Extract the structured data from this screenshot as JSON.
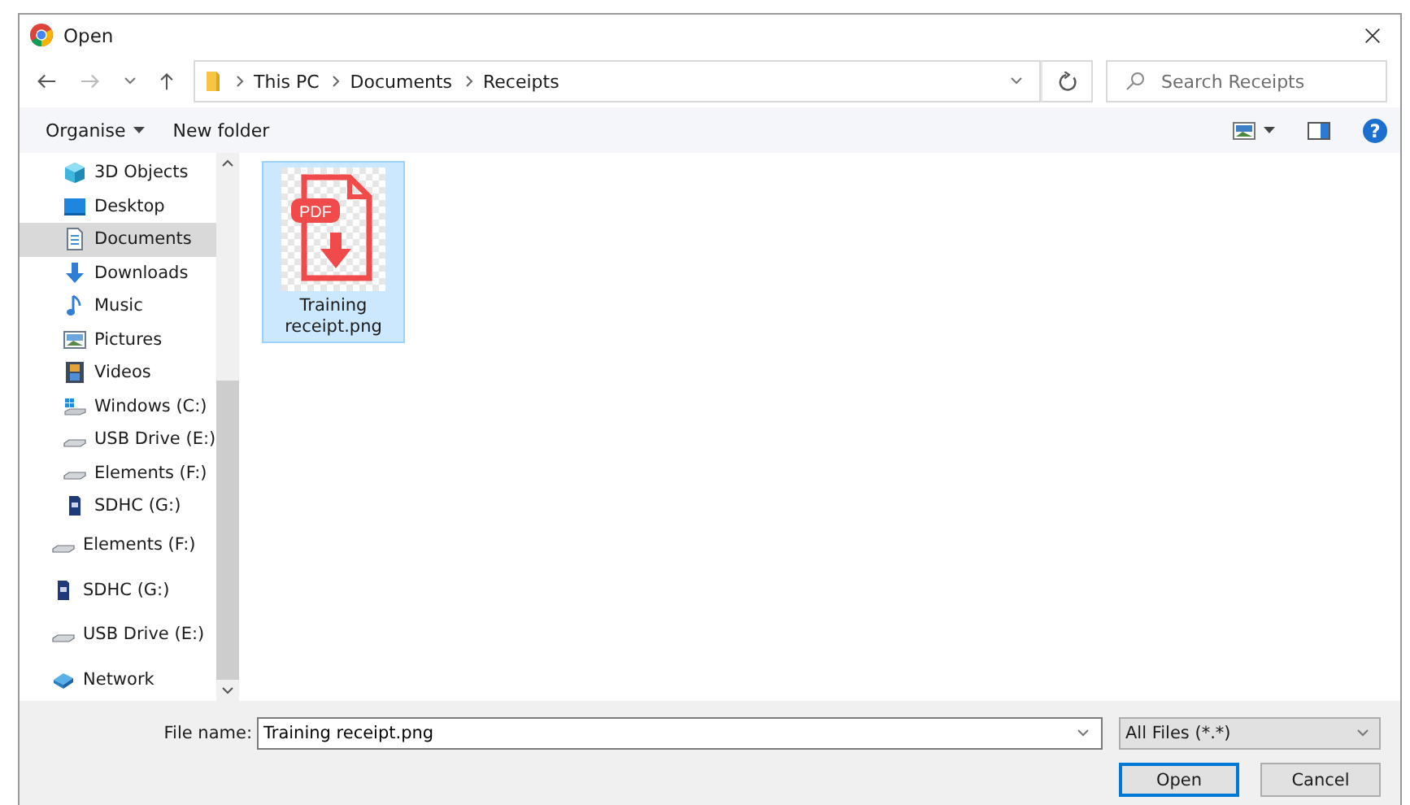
{
  "window": {
    "title": "Open"
  },
  "address": {
    "crumbs": [
      "This PC",
      "Documents",
      "Receipts"
    ]
  },
  "search": {
    "placeholder": "Search Receipts"
  },
  "toolbar": {
    "organise": "Organise",
    "new_folder": "New folder",
    "help": "?"
  },
  "sidebar": {
    "this_pc_items": [
      {
        "label": "3D Objects",
        "kind": "cube",
        "selected": false
      },
      {
        "label": "Desktop",
        "kind": "desktop",
        "selected": false
      },
      {
        "label": "Documents",
        "kind": "document",
        "selected": true
      },
      {
        "label": "Downloads",
        "kind": "download",
        "selected": false
      },
      {
        "label": "Music",
        "kind": "music",
        "selected": false
      },
      {
        "label": "Pictures",
        "kind": "pictures",
        "selected": false
      },
      {
        "label": "Videos",
        "kind": "videos",
        "selected": false
      },
      {
        "label": "Windows (C:)",
        "kind": "system",
        "selected": false
      },
      {
        "label": "USB Drive (E:)",
        "kind": "drive",
        "selected": false
      },
      {
        "label": "Elements (F:)",
        "kind": "drive",
        "selected": false
      },
      {
        "label": "SDHC (G:)",
        "kind": "sd",
        "selected": false
      }
    ],
    "root_items": [
      {
        "label": "Elements (F:)",
        "kind": "drive",
        "selected": false
      },
      {
        "label": "SDHC (G:)",
        "kind": "sd",
        "selected": false
      },
      {
        "label": "USB Drive (E:)",
        "kind": "drive",
        "selected": false
      },
      {
        "label": "Network",
        "kind": "network",
        "selected": false
      }
    ]
  },
  "files": [
    {
      "name": "Training receipt.png",
      "badge": "PDF",
      "selected": true
    }
  ],
  "footer": {
    "file_name_label": "File name:",
    "file_name": "Training receipt.png",
    "file_type": "All Files (*.*)",
    "buttons": [
      {
        "label": "Open",
        "kind": "default"
      },
      {
        "label": "Cancel",
        "kind": "normal"
      }
    ]
  }
}
